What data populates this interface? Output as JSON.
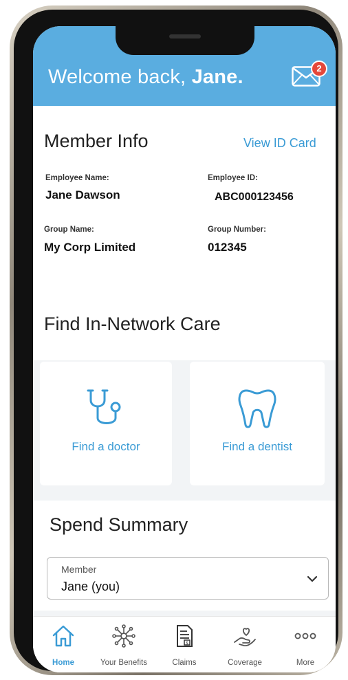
{
  "header": {
    "welcome_prefix": "Welcome back, ",
    "welcome_name": "Jane.",
    "mail_badge": "2",
    "mail_icon": "envelope-icon",
    "background": "#5aade0"
  },
  "member_info": {
    "title": "Member Info",
    "view_id_card": "View ID Card",
    "employee_name_label": "Employee Name:",
    "employee_name": "Jane Dawson",
    "employee_id_label": "Employee ID:",
    "employee_id": "ABC000123456",
    "group_name_label": "Group Name:",
    "group_name": "My Corp Limited",
    "group_number_label": "Group Number:",
    "group_number": "012345"
  },
  "find_care": {
    "title": "Find In-Network Care",
    "cards": [
      {
        "label": "Find a doctor",
        "icon": "stethoscope-icon"
      },
      {
        "label": "Find a dentist",
        "icon": "tooth-icon"
      }
    ]
  },
  "spend_summary": {
    "title": "Spend Summary",
    "member_label": "Member",
    "member_value": "Jane (you)"
  },
  "tabbar": {
    "tabs": [
      {
        "label": "Home",
        "icon": "home-icon",
        "active": true
      },
      {
        "label": "Your Benefits",
        "icon": "benefits-network-icon"
      },
      {
        "label": "Claims",
        "icon": "claims-document-icon"
      },
      {
        "label": "Coverage",
        "icon": "coverage-hand-icon"
      },
      {
        "label": "More",
        "icon": "more-dots-icon"
      }
    ]
  },
  "colors": {
    "accent": "#3a9bd5",
    "badge": "#e4473a"
  }
}
